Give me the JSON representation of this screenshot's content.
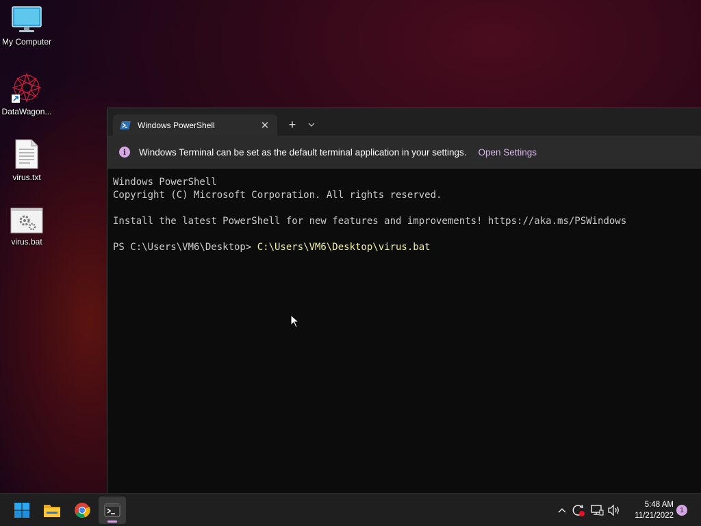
{
  "desktop": {
    "icons": [
      {
        "label": "My Computer",
        "icon": "monitor-icon"
      },
      {
        "label": "DataWagon...",
        "icon": "shortcut-icon"
      },
      {
        "label": "virus.txt",
        "icon": "text-file-icon"
      },
      {
        "label": "virus.bat",
        "icon": "batch-file-icon"
      }
    ]
  },
  "terminal": {
    "tab": {
      "title": "Windows PowerShell",
      "icon": "powershell-icon"
    },
    "new_tab_symbol": "+",
    "close_symbol": "✕",
    "infobar": {
      "icon_glyph": "i",
      "message": "Windows Terminal can be set as the default terminal application in your settings.",
      "link": "Open Settings"
    },
    "console": {
      "line1": "Windows PowerShell",
      "line2": "Copyright (C) Microsoft Corporation. All rights reserved.",
      "line3": "Install the latest PowerShell for new features and improvements! https://aka.ms/PSWindows",
      "prompt": "PS C:\\Users\\VM6\\Desktop> ",
      "command": "C:\\Users\\VM6\\Desktop\\virus.bat"
    }
  },
  "taskbar": {
    "apps": [
      "start-icon",
      "file-explorer-icon",
      "chrome-icon",
      "terminal-icon"
    ],
    "tray": {
      "time": "5:48 AM",
      "date": "11/21/2022",
      "notification_count": "1"
    }
  },
  "colors": {
    "accent": "#d7a6e6",
    "console_text": "#cccccc",
    "command_text": "#f2f2a0",
    "terminal_bg": "#0c0c0c"
  }
}
